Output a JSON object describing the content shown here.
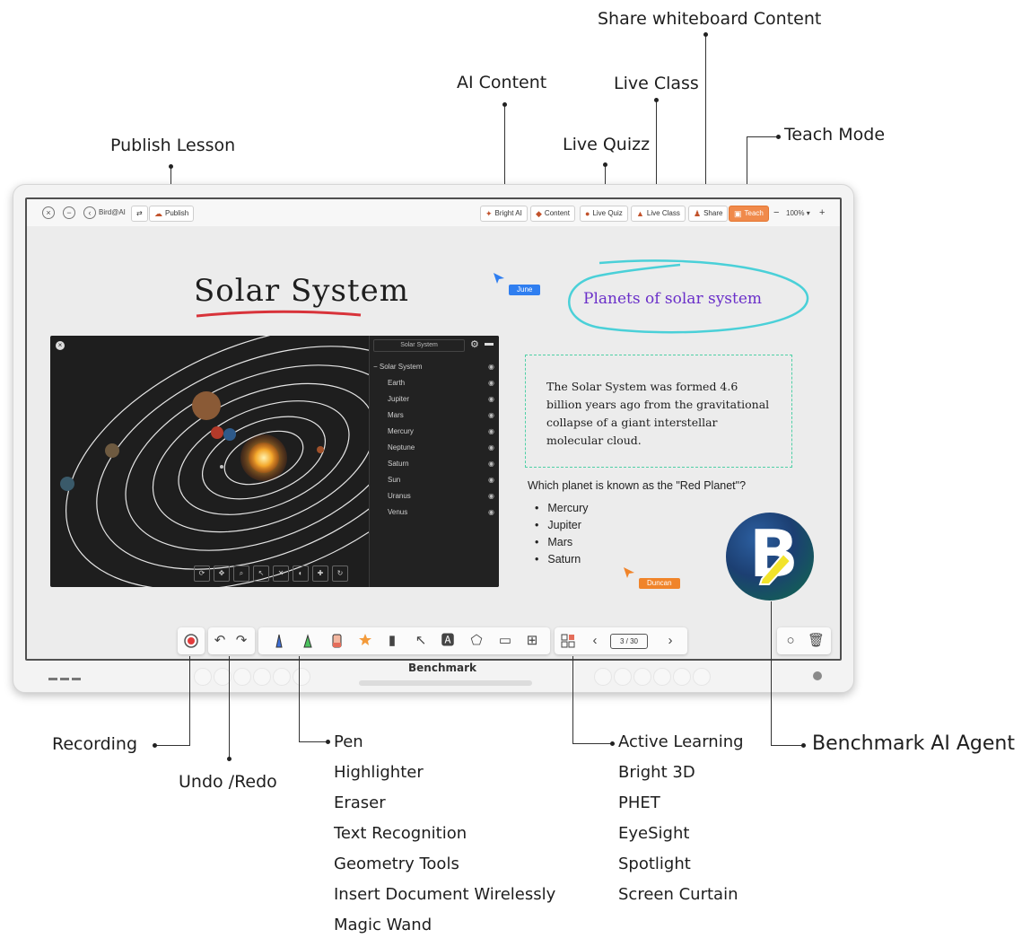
{
  "callouts": {
    "share": "Share whiteboard Content",
    "ai_content": "AI Content",
    "live_class": "Live Class",
    "live_quizz": "Live Quizz",
    "teach_mode": "Teach Mode",
    "publish_lesson": "Publish Lesson",
    "recording": "Recording",
    "undo_redo": "Undo /Redo",
    "benchmark_ai_agent": "Benchmark AI Agent"
  },
  "pen_list": [
    "Pen",
    "Highlighter",
    "Eraser",
    "Text Recognition",
    "Geometry Tools",
    "Insert Document Wirelessly",
    "Magic Wand"
  ],
  "active_list": [
    "Active Learning",
    "Bright 3D",
    "PHET",
    "EyeSight",
    "Spotlight",
    "Screen Curtain"
  ],
  "topbar": {
    "bird_label": "Bird@AI",
    "publish_label": "Publish",
    "bright_ai_label": "Bright AI",
    "content_label": "Content",
    "live_quiz_label": "Live Quiz",
    "live_class_label": "Live Class",
    "share_label": "Share",
    "teach_label": "Teach",
    "zoom": "100%"
  },
  "board": {
    "title": "Solar System",
    "planets_label": "Planets of solar system",
    "cursor_june": "June",
    "cursor_duncan": "Duncan",
    "fact": "The Solar System was formed 4.6 billion years ago from the gravitational collapse of a giant interstellar molecular cloud.",
    "question": "Which planet is known as the \"Red Planet\"?",
    "options": [
      "Mercury",
      "Jupiter",
      "Mars",
      "Saturn"
    ],
    "page_counter": "3 / 30",
    "agent_letter": "B"
  },
  "sim": {
    "panel_title": "Solar System",
    "tree_root": "Solar System",
    "items": [
      "Earth",
      "Jupiter",
      "Mars",
      "Mercury",
      "Neptune",
      "Saturn",
      "Sun",
      "Uranus",
      "Venus"
    ],
    "tools": [
      "Rotate",
      "Move",
      "Zoom",
      "Select",
      "Locate",
      "Hide",
      "Reinitiate",
      "Reset"
    ]
  },
  "device": {
    "brand": "Benchmark"
  },
  "colors": {
    "teach": "#f08a4b",
    "june": "#2f7ef0",
    "duncan": "#f0842a",
    "planets_ring": "#4ad0d8",
    "planets_text": "#6a2fc9",
    "title_underline": "#d8333a",
    "fact_border": "#4fd0a6"
  }
}
